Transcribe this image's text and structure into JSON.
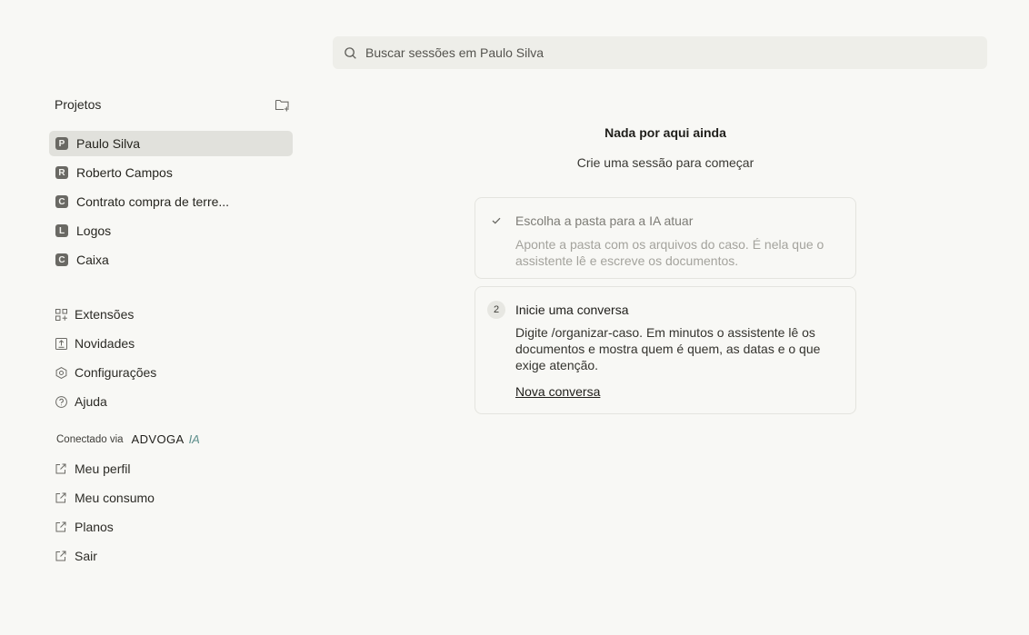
{
  "search": {
    "placeholder": "Buscar sessões em Paulo Silva",
    "value": ""
  },
  "sidebar": {
    "projects_title": "Projetos",
    "projects": [
      {
        "initial": "P",
        "label": "Paulo Silva",
        "active": true
      },
      {
        "initial": "R",
        "label": "Roberto Campos"
      },
      {
        "initial": "C",
        "label": "Contrato compra de terre..."
      },
      {
        "initial": "L",
        "label": "Logos"
      },
      {
        "initial": "C",
        "label": "Caixa"
      }
    ],
    "nav": [
      {
        "icon": "extensions-icon",
        "label": "Extensões"
      },
      {
        "icon": "news-icon",
        "label": "Novidades"
      },
      {
        "icon": "settings-icon",
        "label": "Configurações"
      },
      {
        "icon": "help-icon",
        "label": "Ajuda"
      }
    ],
    "connected": {
      "text": "Conectado via",
      "brand": "ADVOGA",
      "brand_accent": "IA"
    },
    "account": [
      {
        "icon": "external-link-icon",
        "label": "Meu perfil"
      },
      {
        "icon": "external-link-icon",
        "label": "Meu consumo"
      },
      {
        "icon": "external-link-icon",
        "label": "Planos"
      },
      {
        "icon": "external-link-icon",
        "label": "Sair"
      }
    ]
  },
  "main": {
    "empty_title": "Nada por aqui ainda",
    "empty_subtitle": "Crie uma sessão para começar",
    "steps": [
      {
        "marker": "check-icon",
        "status": "done",
        "title": "Escolha a pasta para a IA atuar",
        "description": "Aponte a pasta com os arquivos do caso. É nela que o assistente lê e escreve os documentos."
      },
      {
        "marker": "2",
        "status": "current",
        "title": "Inicie uma conversa",
        "description": "Digite /organizar-caso. Em minutos o assistente lê os documentos e mostra quem é quem, as datas e o que exige atenção.",
        "link": "Nova conversa"
      }
    ]
  },
  "colors": {
    "background": "#f8f8f5",
    "active_item": "#e1e1dc",
    "search_bg": "#eeeee9",
    "brand_accent": "#5e8f8c"
  }
}
